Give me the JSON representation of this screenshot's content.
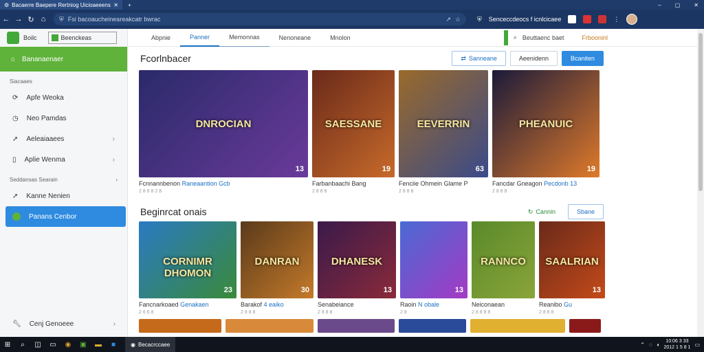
{
  "browser": {
    "tab_title": "Bacaerre Baepere Rertniog Uicioaeeens",
    "url": "Fsi bacoaucheineareakcatr bwrac",
    "right_label": "Senceccdeocs f icnlcicaee"
  },
  "sidebar": {
    "brand": "Boilc",
    "search_label": "Beenckeas",
    "home_label": "Bananaenaer",
    "section1": "Siacaaes",
    "items": [
      {
        "label": "Apfe Weoka",
        "icon": "circle-arrow-icon"
      },
      {
        "label": "Neo Pamdas",
        "icon": "clock-icon"
      },
      {
        "label": "Aeleaiaaees",
        "icon": "arrow-icon"
      },
      {
        "label": "Aplie Wenma",
        "icon": "file-icon"
      }
    ],
    "section2": "Seddansas Searain",
    "items2": [
      {
        "label": "Kanne Nenien",
        "icon": "arrow-icon"
      },
      {
        "label": "Panans Cenbor",
        "icon": "globe-icon"
      }
    ],
    "bottom": {
      "label": "Cenj Genoeee",
      "icon": "wrench-icon"
    }
  },
  "tabs": {
    "items": [
      "Abpnie",
      "Panner",
      "Memonnas",
      "Nenoneane",
      "Mnolon"
    ],
    "search_label": "Beuttaenc baet",
    "brand": "Frbooninl"
  },
  "section1": {
    "title": "Fcorlnbacer",
    "btn1": "Sanneane",
    "btn2": "Aeenidenn",
    "btn3": "Bcaniten",
    "cards": [
      {
        "title": "Fcnnannbenon",
        "title_hl": "Raneaantion Gcb",
        "meta": "2 8 6 8 2 8",
        "badge": "13",
        "caption": "DNROCIAN",
        "c1": "#2a2a6a",
        "c2": "#6a3a9a"
      },
      {
        "title": "Farbanbaachi Bang",
        "meta": "2 8 8 8",
        "badge": "19",
        "caption": "SAESSANE",
        "c1": "#6a2a1a",
        "c2": "#c76a2a"
      },
      {
        "title": "Fenciie Ohmein Glame P",
        "meta": "2 8 8 8",
        "badge": "63",
        "caption": "EEVERRIN",
        "c1": "#9a6a2a",
        "c2": "#3a4a8a"
      },
      {
        "title": "Fancdar Gneagon",
        "title_hl": "Pecdonb 13",
        "meta": "2 8 8 8",
        "badge": "19",
        "caption": "PHEANUIC",
        "c1": "#1a1a3a",
        "c2": "#e07a2a"
      }
    ]
  },
  "section2": {
    "title": "Beginrcat onais",
    "btn1": "Cannin",
    "btn2": "Sbane",
    "cards": [
      {
        "title": "Fancnarkoaed",
        "title_hl": "Genakaen",
        "meta": "2 6 6 8",
        "badge": "23",
        "caption": "CORNIMR DHOMON",
        "c1": "#2a7ac4",
        "c2": "#3a8a3a"
      },
      {
        "title": "Barakof",
        "title_hl": "4 eaiko",
        "meta": "2 8 8 8",
        "badge": "30",
        "caption": "DANRAN",
        "c1": "#5a3a1a",
        "c2": "#c47a2a"
      },
      {
        "title": "Senabeiance",
        "meta": "2 8 8 8",
        "badge": "13",
        "caption": "DHANESK",
        "c1": "#3a1a4a",
        "c2": "#8a2a3a"
      },
      {
        "title": "Raoin",
        "title_hl": "N obale",
        "meta": "2 8",
        "badge": "13",
        "caption": "",
        "c1": "#4a6ad4",
        "c2": "#a43ac4"
      },
      {
        "title": "Neiconaean",
        "meta": "2 8 8 8 8",
        "badge": "",
        "caption": "RANNCO",
        "c1": "#5a8a2a",
        "c2": "#8aa43a"
      },
      {
        "title": "Reanibo",
        "title_hl": "Gu",
        "meta": "2 8 8 8",
        "badge": "13",
        "caption": "SAALRIAN",
        "c1": "#6a2a1a",
        "c2": "#c44a1a"
      }
    ]
  },
  "row3_colors": [
    "#c46a1a",
    "#d88a3a",
    "#6a4a8a",
    "#2a4a9a",
    "#e0b030",
    "#8a1a1a"
  ],
  "taskbar": {
    "app_label": "Becacrccaee",
    "time": "10:06 3 33",
    "date": "2012 1 5 8 1"
  }
}
